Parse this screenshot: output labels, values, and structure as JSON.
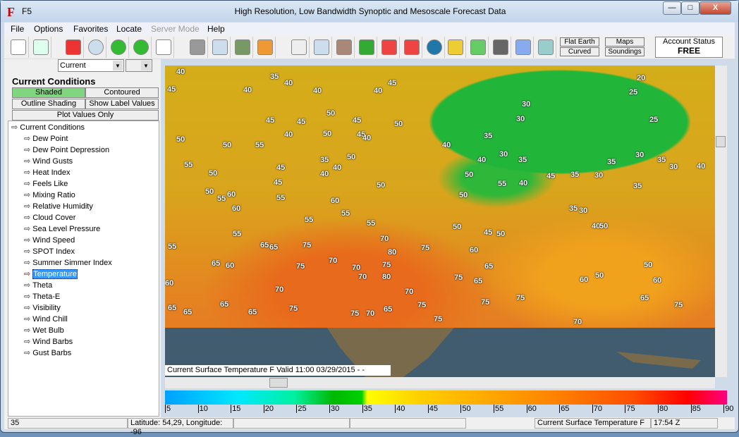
{
  "window": {
    "app_name": "F5",
    "title": "High Resolution, Low Bandwidth Synoptic and Mesoscale Forecast Data",
    "minimize": "—",
    "maximize": "□",
    "close": "X"
  },
  "menu": [
    "File",
    "Options",
    "Favorites",
    "Locate",
    "Server Mode",
    "Help"
  ],
  "toolbar": {
    "icons": [
      "new-document-icon",
      "refresh-icon",
      "color-map-icon",
      "clock-icon",
      "back-arrow-icon",
      "forward-arrow-icon",
      "filmstrip-icon",
      "screen-icon",
      "copy-icon",
      "terrain-icon",
      "layers-icon",
      "magnifier-icon",
      "zoom-document-icon",
      "pan-hand-icon",
      "home-icon",
      "zoom-in-icon",
      "zoom-out-icon",
      "globe-icon",
      "plane-icon",
      "radar-icon",
      "satellite-icon",
      "calculator-icon",
      "hurricane-icon"
    ],
    "flat_earth": "Flat Earth",
    "curved": "Curved",
    "maps": "Maps",
    "soundings": "Soundings",
    "account_status_label": "Account Status",
    "account_status_value": "FREE"
  },
  "selector": {
    "time": "Current",
    "second": ""
  },
  "panel": {
    "heading": "Current Conditions",
    "shaded": "Shaded",
    "contoured": "Contoured",
    "outline_shading": "Outline Shading",
    "show_label_values": "Show Label Values",
    "plot_values_only": "Plot Values Only"
  },
  "tree": {
    "root": "Current Conditions",
    "items": [
      "Dew Point",
      "Dew Point Depression",
      "Wind Gusts",
      "Heat Index",
      "Feels Like",
      "Mixing Ratio",
      "Relative Humidity",
      "Cloud Cover",
      "Sea Level Pressure",
      "Wind Speed",
      "SPOT Index",
      "Summer Simmer Index",
      "Temperature",
      "Theta",
      "Theta-E",
      "Visibility",
      "Wind Chill",
      "Wet Bulb",
      "Wind Barbs",
      "Gust Barbs"
    ],
    "selected": "Temperature"
  },
  "map": {
    "caption": "Current Surface Temperature  F    Valid 11:00  03/29/2015   -    -",
    "labels": [
      "40",
      "35",
      "40",
      "45",
      "40",
      "40",
      "40",
      "45",
      "20",
      "25",
      "30",
      "50",
      "30",
      "25",
      "50",
      "45",
      "45",
      "45",
      "50",
      "35",
      "40",
      "50",
      "45",
      "50",
      "55",
      "40",
      "40",
      "30",
      "35",
      "30",
      "35",
      "30",
      "40",
      "35",
      "40",
      "40",
      "50",
      "55",
      "45",
      "40",
      "50",
      "35",
      "30",
      "35",
      "50",
      "45",
      "50",
      "55",
      "40",
      "45",
      "35",
      "50",
      "55",
      "60",
      "50",
      "55",
      "60",
      "55",
      "55",
      "60",
      "55",
      "35",
      "30",
      "40",
      "50",
      "50",
      "45",
      "50",
      "55",
      "55",
      "65",
      "65",
      "75",
      "70",
      "75",
      "80",
      "60",
      "65",
      "60",
      "75",
      "70",
      "70",
      "75",
      "65",
      "50",
      "60",
      "70",
      "80",
      "75",
      "65",
      "50",
      "60",
      "70",
      "70",
      "75",
      "75",
      "65",
      "75",
      "65",
      "65",
      "65",
      "75",
      "75",
      "70",
      "65",
      "75",
      "65",
      "75",
      "70",
      "60"
    ]
  },
  "colorbar": {
    "ticks": [
      "5",
      "10",
      "15",
      "20",
      "25",
      "30",
      "35",
      "40",
      "45",
      "50",
      "55",
      "60",
      "65",
      "70",
      "75",
      "80",
      "85",
      "90"
    ]
  },
  "status": {
    "left": "35",
    "coords": "Latitude: 54,29, Longitude: -96",
    "p3": "",
    "p4": "",
    "product": "Current Surface Temperature  F",
    "time": "17:54 Z"
  }
}
